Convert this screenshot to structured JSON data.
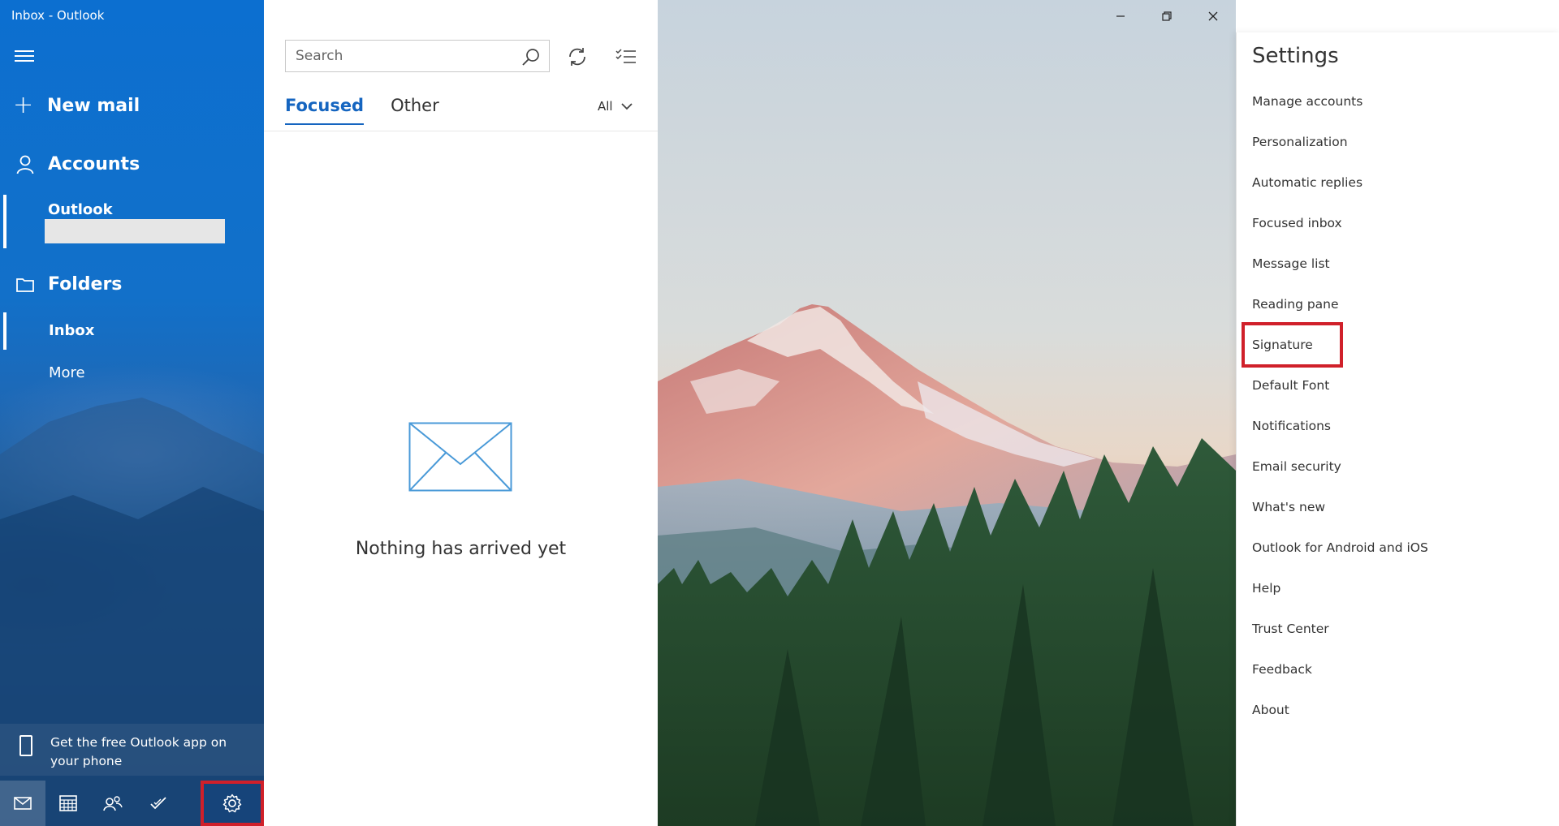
{
  "window": {
    "title": "Inbox - Outlook"
  },
  "nav": {
    "new_mail": "New mail",
    "accounts": "Accounts",
    "account_name": "Outlook",
    "folders": "Folders",
    "folder_items": [
      "Inbox",
      "More"
    ],
    "promo": "Get the free Outlook app on your phone",
    "bottom_icons": [
      "mail-icon",
      "calendar-icon",
      "people-icon",
      "todo-icon",
      "settings-icon"
    ]
  },
  "list": {
    "search_placeholder": "Search",
    "tabs": [
      "Focused",
      "Other"
    ],
    "filter": "All",
    "empty_message": "Nothing has arrived yet"
  },
  "settings": {
    "title": "Settings",
    "items": [
      "Manage accounts",
      "Personalization",
      "Automatic replies",
      "Focused inbox",
      "Message list",
      "Reading pane",
      "Signature",
      "Default Font",
      "Notifications",
      "Email security",
      "What's new",
      "Outlook for Android and iOS",
      "Help",
      "Trust Center",
      "Feedback",
      "About"
    ],
    "highlighted_item": "Signature"
  },
  "colors": {
    "accent": "#1565c0",
    "highlight_box": "#d0202a"
  }
}
